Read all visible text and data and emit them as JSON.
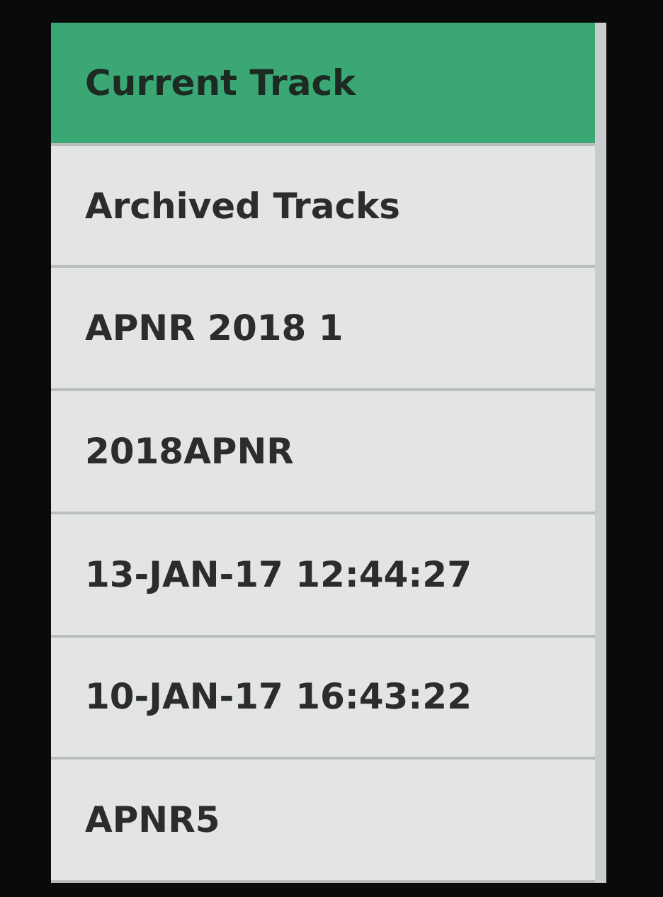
{
  "items": [
    {
      "label": "Current Track",
      "selected": true
    },
    {
      "label": "Archived Tracks",
      "selected": false
    },
    {
      "label": "APNR 2018 1",
      "selected": false
    },
    {
      "label": "2018APNR",
      "selected": false
    },
    {
      "label": "13-JAN-17 12:44:27",
      "selected": false
    },
    {
      "label": "10-JAN-17 16:43:22",
      "selected": false
    },
    {
      "label": "APNR5",
      "selected": false
    }
  ]
}
